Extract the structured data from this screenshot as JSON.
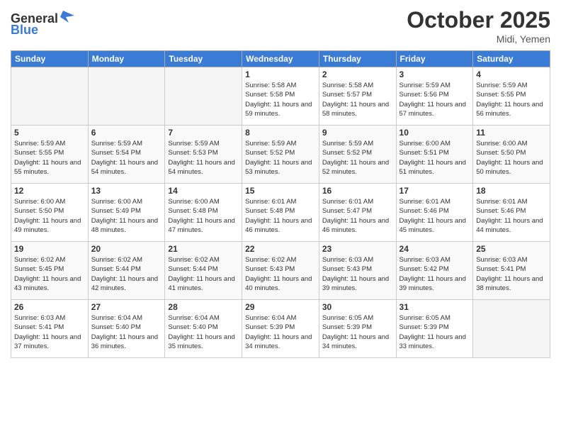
{
  "header": {
    "logo_general": "General",
    "logo_blue": "Blue",
    "month": "October 2025",
    "location": "Midi, Yemen"
  },
  "weekdays": [
    "Sunday",
    "Monday",
    "Tuesday",
    "Wednesday",
    "Thursday",
    "Friday",
    "Saturday"
  ],
  "weeks": [
    [
      {
        "day": "",
        "info": ""
      },
      {
        "day": "",
        "info": ""
      },
      {
        "day": "",
        "info": ""
      },
      {
        "day": "1",
        "info": "Sunrise: 5:58 AM\nSunset: 5:58 PM\nDaylight: 11 hours and 59 minutes."
      },
      {
        "day": "2",
        "info": "Sunrise: 5:58 AM\nSunset: 5:57 PM\nDaylight: 11 hours and 58 minutes."
      },
      {
        "day": "3",
        "info": "Sunrise: 5:59 AM\nSunset: 5:56 PM\nDaylight: 11 hours and 57 minutes."
      },
      {
        "day": "4",
        "info": "Sunrise: 5:59 AM\nSunset: 5:55 PM\nDaylight: 11 hours and 56 minutes."
      }
    ],
    [
      {
        "day": "5",
        "info": "Sunrise: 5:59 AM\nSunset: 5:55 PM\nDaylight: 11 hours and 55 minutes."
      },
      {
        "day": "6",
        "info": "Sunrise: 5:59 AM\nSunset: 5:54 PM\nDaylight: 11 hours and 54 minutes."
      },
      {
        "day": "7",
        "info": "Sunrise: 5:59 AM\nSunset: 5:53 PM\nDaylight: 11 hours and 54 minutes."
      },
      {
        "day": "8",
        "info": "Sunrise: 5:59 AM\nSunset: 5:52 PM\nDaylight: 11 hours and 53 minutes."
      },
      {
        "day": "9",
        "info": "Sunrise: 5:59 AM\nSunset: 5:52 PM\nDaylight: 11 hours and 52 minutes."
      },
      {
        "day": "10",
        "info": "Sunrise: 6:00 AM\nSunset: 5:51 PM\nDaylight: 11 hours and 51 minutes."
      },
      {
        "day": "11",
        "info": "Sunrise: 6:00 AM\nSunset: 5:50 PM\nDaylight: 11 hours and 50 minutes."
      }
    ],
    [
      {
        "day": "12",
        "info": "Sunrise: 6:00 AM\nSunset: 5:50 PM\nDaylight: 11 hours and 49 minutes."
      },
      {
        "day": "13",
        "info": "Sunrise: 6:00 AM\nSunset: 5:49 PM\nDaylight: 11 hours and 48 minutes."
      },
      {
        "day": "14",
        "info": "Sunrise: 6:00 AM\nSunset: 5:48 PM\nDaylight: 11 hours and 47 minutes."
      },
      {
        "day": "15",
        "info": "Sunrise: 6:01 AM\nSunset: 5:48 PM\nDaylight: 11 hours and 46 minutes."
      },
      {
        "day": "16",
        "info": "Sunrise: 6:01 AM\nSunset: 5:47 PM\nDaylight: 11 hours and 46 minutes."
      },
      {
        "day": "17",
        "info": "Sunrise: 6:01 AM\nSunset: 5:46 PM\nDaylight: 11 hours and 45 minutes."
      },
      {
        "day": "18",
        "info": "Sunrise: 6:01 AM\nSunset: 5:46 PM\nDaylight: 11 hours and 44 minutes."
      }
    ],
    [
      {
        "day": "19",
        "info": "Sunrise: 6:02 AM\nSunset: 5:45 PM\nDaylight: 11 hours and 43 minutes."
      },
      {
        "day": "20",
        "info": "Sunrise: 6:02 AM\nSunset: 5:44 PM\nDaylight: 11 hours and 42 minutes."
      },
      {
        "day": "21",
        "info": "Sunrise: 6:02 AM\nSunset: 5:44 PM\nDaylight: 11 hours and 41 minutes."
      },
      {
        "day": "22",
        "info": "Sunrise: 6:02 AM\nSunset: 5:43 PM\nDaylight: 11 hours and 40 minutes."
      },
      {
        "day": "23",
        "info": "Sunrise: 6:03 AM\nSunset: 5:43 PM\nDaylight: 11 hours and 39 minutes."
      },
      {
        "day": "24",
        "info": "Sunrise: 6:03 AM\nSunset: 5:42 PM\nDaylight: 11 hours and 39 minutes."
      },
      {
        "day": "25",
        "info": "Sunrise: 6:03 AM\nSunset: 5:41 PM\nDaylight: 11 hours and 38 minutes."
      }
    ],
    [
      {
        "day": "26",
        "info": "Sunrise: 6:03 AM\nSunset: 5:41 PM\nDaylight: 11 hours and 37 minutes."
      },
      {
        "day": "27",
        "info": "Sunrise: 6:04 AM\nSunset: 5:40 PM\nDaylight: 11 hours and 36 minutes."
      },
      {
        "day": "28",
        "info": "Sunrise: 6:04 AM\nSunset: 5:40 PM\nDaylight: 11 hours and 35 minutes."
      },
      {
        "day": "29",
        "info": "Sunrise: 6:04 AM\nSunset: 5:39 PM\nDaylight: 11 hours and 34 minutes."
      },
      {
        "day": "30",
        "info": "Sunrise: 6:05 AM\nSunset: 5:39 PM\nDaylight: 11 hours and 34 minutes."
      },
      {
        "day": "31",
        "info": "Sunrise: 6:05 AM\nSunset: 5:39 PM\nDaylight: 11 hours and 33 minutes."
      },
      {
        "day": "",
        "info": ""
      }
    ]
  ]
}
